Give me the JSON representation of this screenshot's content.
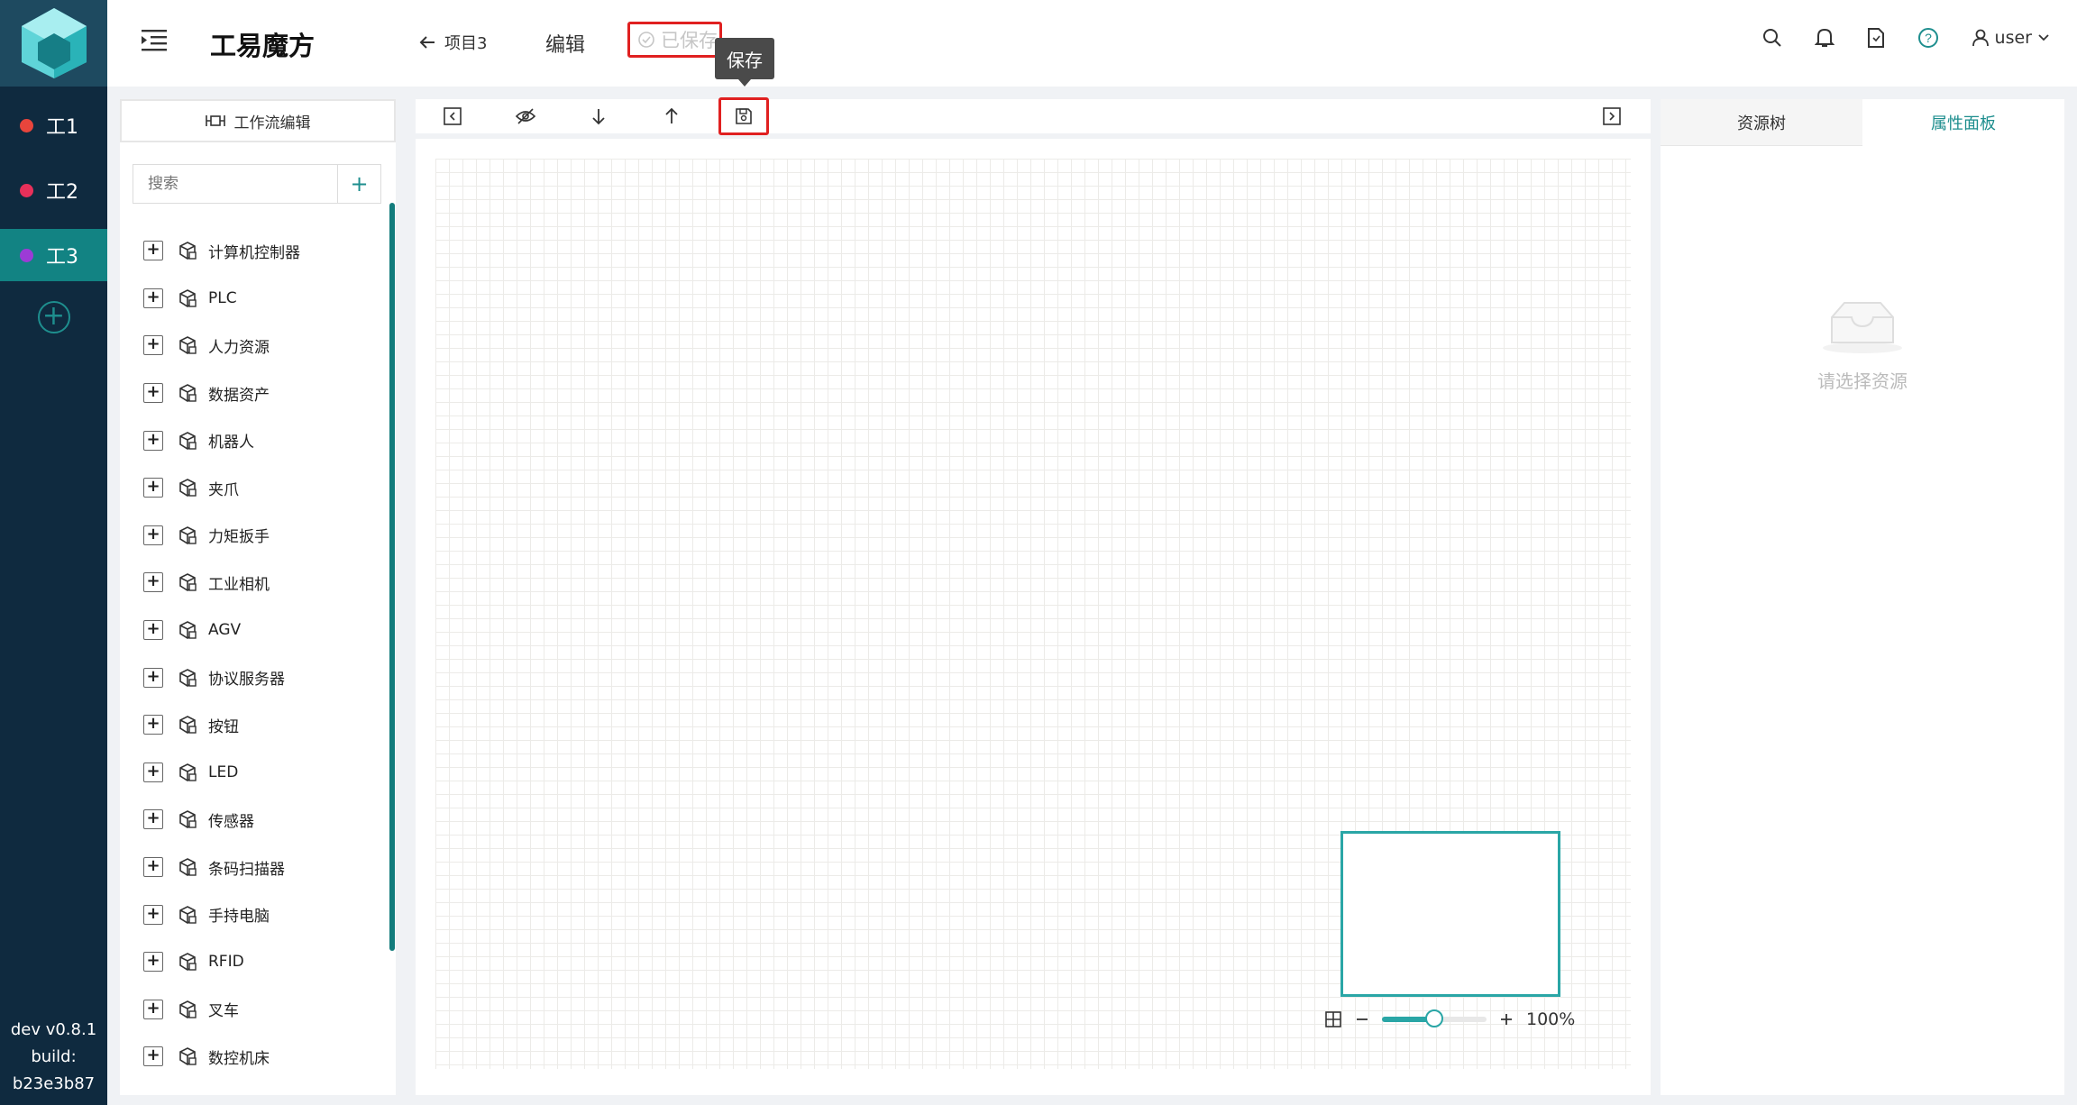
{
  "rail": {
    "items": [
      {
        "label": "工1",
        "color": "#e8453c"
      },
      {
        "label": "工2",
        "color": "#e8305a"
      },
      {
        "label": "工3",
        "color": "#9c3bd6"
      }
    ],
    "add_label": "+",
    "version": "dev v0.8.1",
    "build_label": "build:",
    "build_hash": "b23e3b87"
  },
  "header": {
    "brand": "工易魔方",
    "back_label": "项目3",
    "edit_label": "编辑",
    "saved_label": "已保存",
    "user_label": "user"
  },
  "tooltip": {
    "text": "保存"
  },
  "left_panel": {
    "tab_label": "工作流编辑",
    "search_placeholder": "搜索",
    "add_label": "+",
    "tree": [
      "计算机控制器",
      "PLC",
      "人力资源",
      "数据资产",
      "机器人",
      "夹爪",
      "力矩扳手",
      "工业相机",
      "AGV",
      "协议服务器",
      "按钮",
      "LED",
      "传感器",
      "条码扫描器",
      "手持电脑",
      "RFID",
      "叉车",
      "数控机床"
    ]
  },
  "canvas": {
    "zoom_label": "100%",
    "zoom_fraction": 0.5
  },
  "right_panel": {
    "tabs": [
      "资源树",
      "属性面板"
    ],
    "active_tab": 1,
    "empty_text": "请选择资源"
  },
  "colors": {
    "accent": "#1e8e8e",
    "rail_bg": "#0f2a3f",
    "highlight_red": "#e02020"
  }
}
